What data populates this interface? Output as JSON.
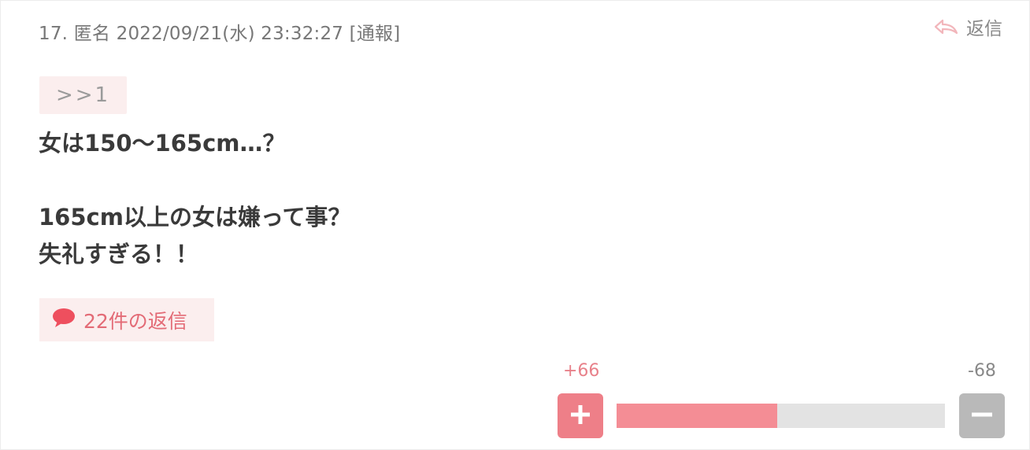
{
  "comment": {
    "number": "17.",
    "author": "匿名",
    "datetime": "2022/09/21(水) 23:32:27",
    "report_label": "[通報]",
    "reply_label": "返信",
    "anchor": ">>1",
    "body_lines": [
      "女は150〜165cm…？",
      "",
      "165cm以上の女は嫌って事？",
      "失礼すぎる！！"
    ],
    "replies_label": "22件の返信"
  },
  "vote": {
    "plus_count": "+66",
    "minus_count": "-68",
    "plus_share": 0.49,
    "plus_color": "#ee7f88",
    "minus_color": "#b9b9b9"
  },
  "icons": {
    "reply": "reply-arrow-icon",
    "replies": "speech-bubble-icon",
    "plus": "plus-icon",
    "minus": "minus-icon"
  }
}
